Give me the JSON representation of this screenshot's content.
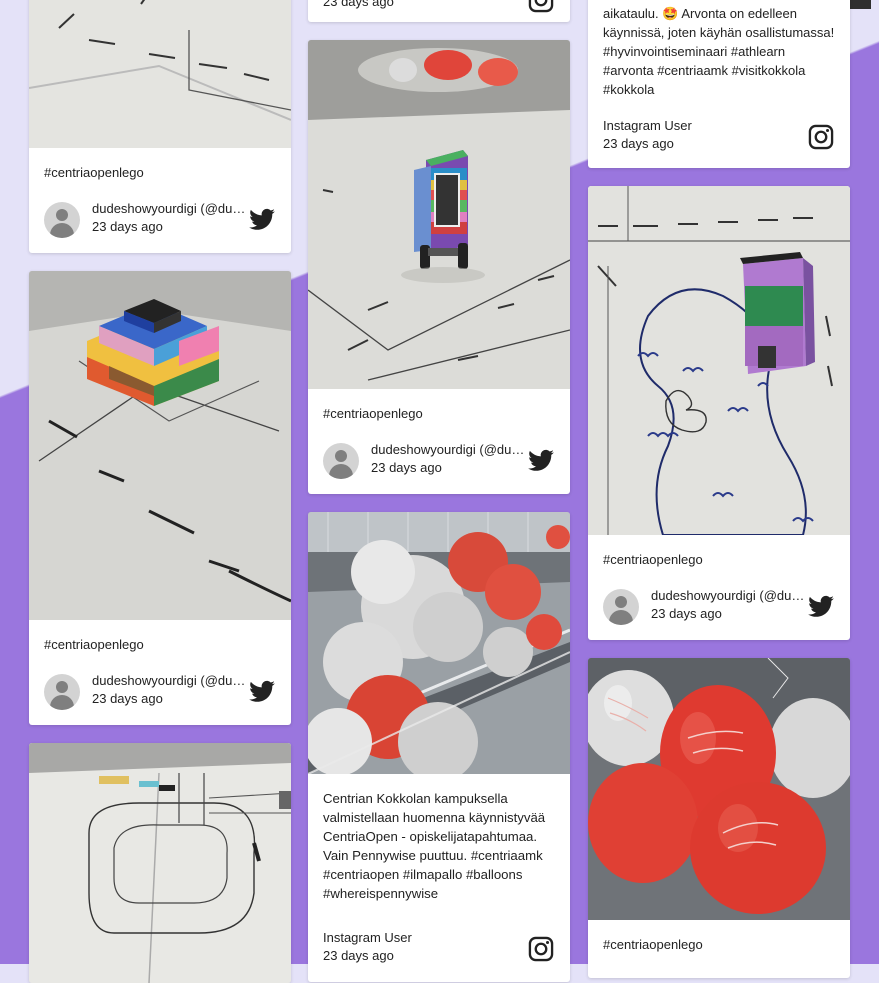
{
  "colors": {
    "bg_light": "#e4e2f8",
    "bg_purple": "#9a76de",
    "twitter": "#222222",
    "instagram": "#222222"
  },
  "col1": {
    "card1": {
      "caption": "#centriaopenlego",
      "user": "dudeshowyourdigi (@dudeshowyourdigi)",
      "time": "23 days ago",
      "source_icon": "twitter-icon"
    },
    "card2": {
      "caption": "#centriaopenlego",
      "user": "dudeshowyourdigi (@dudeshowyourdigi)",
      "time": "23 days ago",
      "source_icon": "twitter-icon"
    }
  },
  "col2": {
    "card0": {
      "time": "23 days ago",
      "source_icon": "instagram-icon"
    },
    "card1": {
      "caption": "#centriaopenlego",
      "user": "dudeshowyourdigi (@dudeshowyourdigi)",
      "time": "23 days ago",
      "source_icon": "twitter-icon"
    },
    "card2": {
      "caption": "Centrian Kokkolan kampuksella valmistellaan huomenna käynnistyvää CentriaOpen - opiskelijatapahtumaa. Vain Pennywise puuttuu. #centriaamk #centriaopen #ilmapallo #balloons #whereispennywise",
      "user": "Instagram User",
      "time": "23 days ago",
      "source_icon": "instagram-icon"
    }
  },
  "col3": {
    "card0": {
      "caption_line1": "aikataulu. 🤩 Arvonta on edelleen",
      "caption_rest": "käynnissä, joten käyhän osallistumassa! #hyvinvointiseminaari #athlearn #arvonta #centriaamk #visitkokkola #kokkola",
      "user": "Instagram User",
      "time": "23 days ago",
      "source_icon": "instagram-icon"
    },
    "card1": {
      "caption": "#centriaopenlego",
      "user": "dudeshowyourdigi (@dudeshowyourdigi)",
      "time": "23 days ago",
      "source_icon": "twitter-icon"
    },
    "card2": {
      "caption": "#centriaopenlego"
    }
  }
}
